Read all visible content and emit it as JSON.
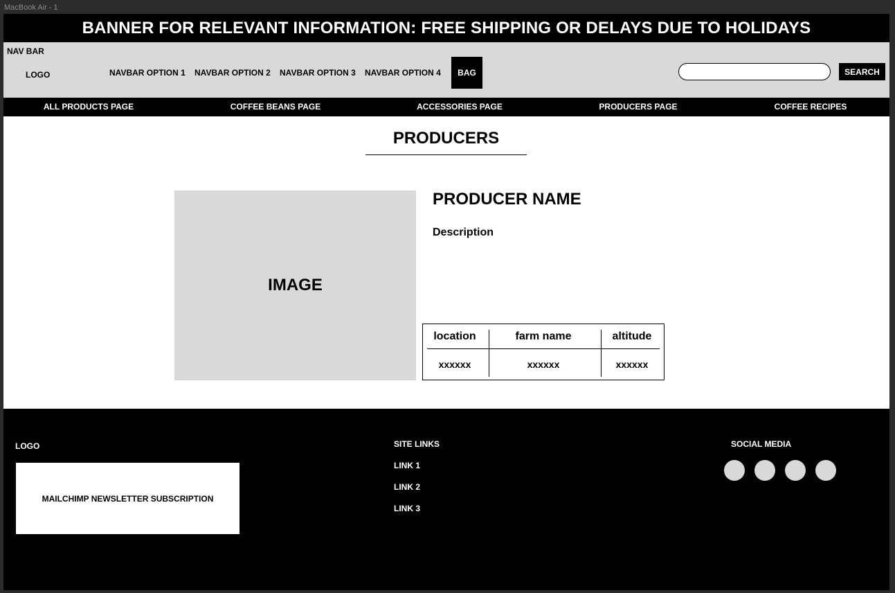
{
  "canvas_label": "MacBook Air - 1",
  "banner": {
    "text": "BANNER FOR RELEVANT INFORMATION: FREE SHIPPING OR DELAYS DUE TO HOLIDAYS"
  },
  "navbar": {
    "title": "NAV BAR",
    "logo": "LOGO",
    "options": [
      "NAVBAR OPTION 1",
      "NAVBAR OPTION 2",
      "NAVBAR OPTION 3",
      "NAVBAR OPTION 4"
    ],
    "bag_label": "BAG",
    "search_placeholder": "",
    "search_label": "SEARCH"
  },
  "categories": [
    "ALL PRODUCTS PAGE",
    "COFFEE BEANS PAGE",
    "ACCESSORIES PAGE",
    "PRODUCERS PAGE",
    "COFFEE RECIPES"
  ],
  "main": {
    "page_title": "PRODUCERS",
    "image_label": "IMAGE",
    "producer_name": "PRODUCER NAME",
    "description": "Description",
    "table": {
      "headers": [
        "location",
        "farm name",
        "altitude"
      ],
      "values": [
        "xxxxxx",
        "xxxxxx",
        "xxxxxx"
      ]
    }
  },
  "footer": {
    "logo": "LOGO",
    "newsletter": "MAILCHIMP NEWSLETTER SUBSCRIPTION",
    "site_links_heading": "SITE LINKS",
    "links": [
      "LINK 1",
      "LINK 2",
      "LINK 3"
    ],
    "social_heading": "SOCIAL MEDIA",
    "social_icons": [
      "social-icon-1",
      "social-icon-2",
      "social-icon-3",
      "social-icon-4"
    ]
  },
  "colors": {
    "accent": "#000000",
    "placeholder_gray": "#d9d9d9",
    "background": "#ffffff"
  }
}
